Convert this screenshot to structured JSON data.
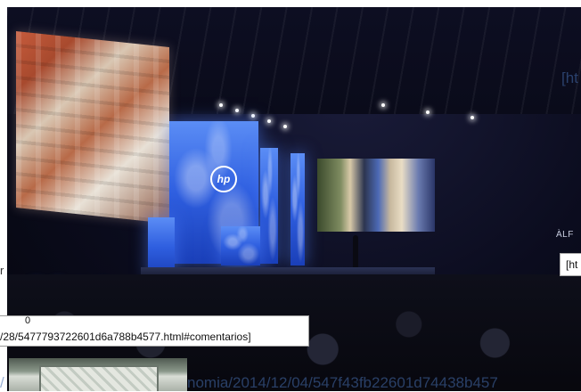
{
  "photo": {
    "logo_text": "hp"
  },
  "overlay": {
    "right_link_fragment": "[ht",
    "right_tag": "ÀLF",
    "right_box_text": "[ht",
    "left_letter": "r",
    "counter": "0",
    "url_box_text": "/28/5477793722601d6a788b4577.html#comentarios]",
    "left_slash": "/",
    "bottom_url": "nomia/2014/12/04/547f43fb22601d74438b457"
  },
  "colors": {
    "stage_blue": "#2f5fe0",
    "link_faded": "#466eaf"
  }
}
